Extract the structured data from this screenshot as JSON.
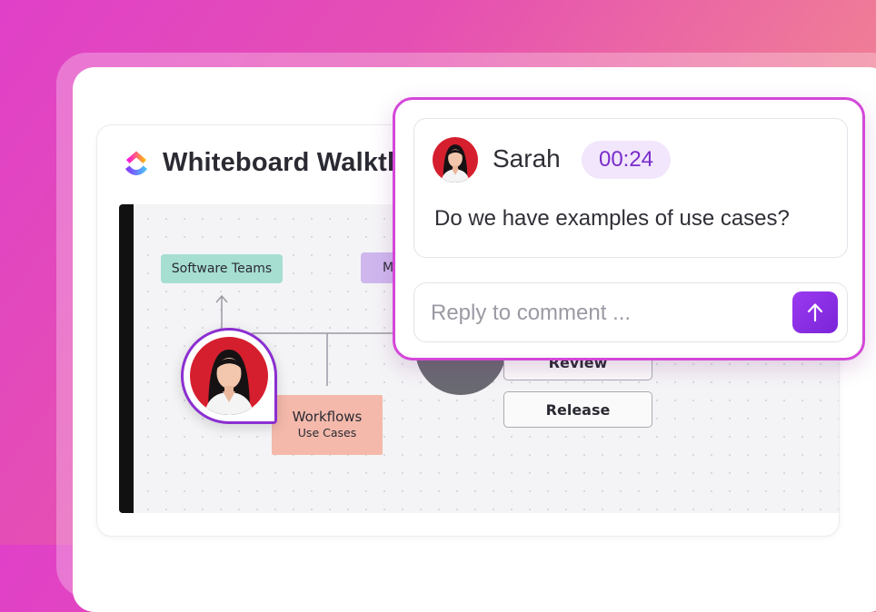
{
  "card": {
    "title": "Whiteboard Walkthrough",
    "logo_icon": "clickup-logo-icon"
  },
  "whiteboard": {
    "boxes": {
      "software_teams": "Software Teams",
      "purple_box": "M",
      "workflows_line1": "Workflows",
      "workflows_line2": "Use Cases",
      "review": "Review",
      "release": "Release"
    }
  },
  "comment": {
    "author": "Sarah",
    "timestamp": "00:24",
    "text": "Do we have examples of use cases?",
    "reply_placeholder": "Reply to comment ...",
    "send_icon": "arrow-up-icon"
  },
  "colors": {
    "accent": "#8b2fd1",
    "panel_border": "#d447d9",
    "timestamp_bg": "#f1e6fc",
    "timestamp_text": "#7a2cc9"
  }
}
